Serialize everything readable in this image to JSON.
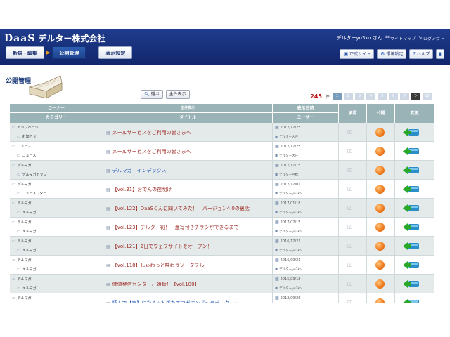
{
  "header": {
    "logo_mark": "DaaS",
    "company": "デルター株式会社",
    "user_name": "デルターyu3ko さん",
    "sitemap_label": "サイトマップ",
    "logout_label": "ログアウト"
  },
  "nav": {
    "items": [
      {
        "label": "新規・編集"
      },
      {
        "label": "公開管理"
      },
      {
        "label": "表示設定"
      }
    ]
  },
  "tools": {
    "official_site": "正式サイト",
    "env_settings": "環境設定",
    "help": "ヘルプ"
  },
  "page": {
    "title": "公開管理"
  },
  "search": {
    "select_label": "選ぶ",
    "show_all_label": "全件表示"
  },
  "pager": {
    "count": "245",
    "unit": "件",
    "pages": [
      "1",
      "2",
      "3",
      "4",
      "5",
      "6",
      "7"
    ],
    "last_page": "10",
    "active_page": "1",
    "next_arrow": "＞"
  },
  "table": {
    "headers": {
      "corner": "コーナー",
      "category": "カテゴリー",
      "full_display": "全件表示",
      "title": "タイトル",
      "display_datetime": "表示日時",
      "user": "ユーザー",
      "approve": "承認",
      "publish": "公開",
      "change": "変更"
    },
    "rows": [
      {
        "corner": "トップページ",
        "category": "お知らせ",
        "title": "メールサービスをご利用の皆さまへ",
        "title_color": "#a0302a",
        "date": "2017/12/25",
        "author": "デルター大庄"
      },
      {
        "corner": "ニュース",
        "category": "ニュース",
        "title": "メールサービスをご利用の皆さまへ",
        "title_color": "#a0302a",
        "date": "2017/12/25",
        "author": "デルター大庄"
      },
      {
        "corner": "デルマガ",
        "category": "デルマガトップ",
        "title": "デルマガ　インデックス",
        "title_color": "#1d55b5",
        "date": "2017/11/15",
        "author": "デルター戸松"
      },
      {
        "corner": "デルマガ",
        "category": "ニュースレター",
        "title": "【vol.31】おでんの夜明け",
        "title_color": "#a0302a",
        "date": "2017/12/01",
        "author": "デルターyu3ko"
      },
      {
        "corner": "デルマガ",
        "category": "メルマガ",
        "title": "【vol.122】DaaSくんに聞いてみた！　バージョン4.0の裏話",
        "title_color": "#a0302a",
        "date": "2017/01/18",
        "author": "デルターyu3ko"
      },
      {
        "corner": "デルマガ",
        "category": "メルマガ",
        "title": "【vol.123】デルター初！　漫写付きチラシができるまで",
        "title_color": "#a0302a",
        "date": "2017/02/15",
        "author": "デルターyu3ko"
      },
      {
        "corner": "デルマガ",
        "category": "メルマガ",
        "title": "【vol.121】2日でウェブサイトをオープン！",
        "title_color": "#a0302a",
        "date": "2016/12/21",
        "author": "デルターyu3ko"
      },
      {
        "corner": "デルマガ",
        "category": "メルマガ",
        "title": "【vol.118】しゅわっと味わうソーダテル",
        "title_color": "#a0302a",
        "date": "2016/09/21",
        "author": "デルターyu3ko"
      },
      {
        "corner": "デルマガ",
        "category": "メルマガ",
        "title": "価値発信センター、始動！【vol.100】",
        "title_color": "#a0302a",
        "date": "2015/03/18",
        "author": "デルターyu3ko"
      },
      {
        "corner": "デルマガ",
        "category": "",
        "title": "読んで【実】になる☆もぎたてマガジン『e-ラボレター』",
        "title_color": "#1d55b5",
        "date": "2012/09/26",
        "author": ""
      }
    ]
  }
}
